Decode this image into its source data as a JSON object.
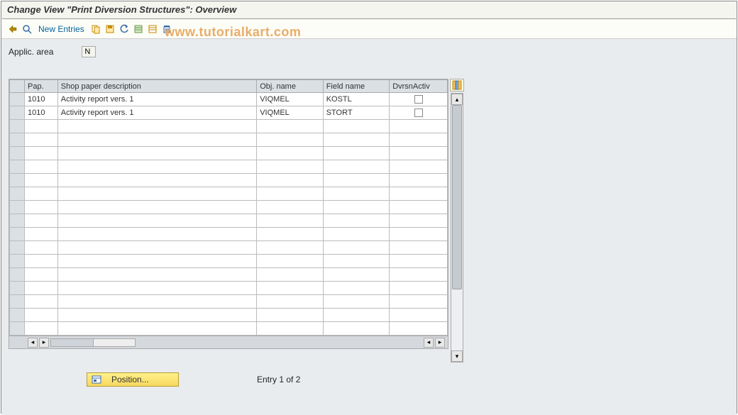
{
  "title": "Change View \"Print Diversion Structures\": Overview",
  "toolbar": {
    "new_entries": "New Entries"
  },
  "watermark": "www.tutorialkart.com",
  "applic": {
    "label": "Applic. area",
    "value": "N"
  },
  "columns": {
    "pap": "Pap.",
    "desc": "Shop paper description",
    "obj": "Obj. name",
    "field": "Field name",
    "dvrsn": "DvrsnActiv"
  },
  "rows": [
    {
      "pap": "1010",
      "desc": "Activity report vers. 1",
      "obj": "VIQMEL",
      "field": "KOSTL",
      "dvrsn": false
    },
    {
      "pap": "1010",
      "desc": "Activity report vers. 1",
      "obj": "VIQMEL",
      "field": "STORT",
      "dvrsn": false
    }
  ],
  "empty_rows": 16,
  "footer": {
    "position": "Position...",
    "entry": "Entry 1 of 2"
  },
  "icons": {
    "toggle": "toggle-icon",
    "find": "find-icon",
    "copy": "copy-icon",
    "save": "save-icon",
    "undo": "undo-icon",
    "select_all": "select-all-icon",
    "deselect_all": "deselect-all-icon",
    "delete": "delete-icon",
    "table_settings": "table-settings-icon"
  }
}
